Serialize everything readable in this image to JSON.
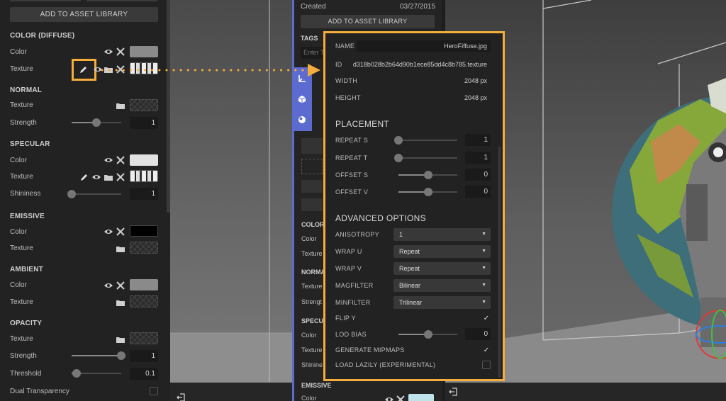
{
  "left_panel": {
    "add_to_library": "ADD TO ASSET LIBRARY",
    "sections": {
      "color_diffuse": "COLOR (DIFFUSE)",
      "normal": "NORMAL",
      "specular": "SPECULAR",
      "emissive": "EMISSIVE",
      "ambient": "AMBIENT",
      "opacity": "OPACITY"
    },
    "labels": {
      "color": "Color",
      "texture": "Texture",
      "strength": "Strength",
      "shininess": "Shininess",
      "threshold": "Threshold",
      "dual_transparency": "Dual Transparency"
    },
    "values": {
      "normal_strength": "1",
      "specular_shininess": "1",
      "opacity_strength": "1",
      "opacity_threshold": "0.1"
    },
    "slider_levels": {
      "normal_strength": 0.5,
      "specular_shininess": 0.0,
      "opacity_strength": 1.0,
      "opacity_threshold": 0.1
    },
    "swatch_colors": {
      "diffuse": "#8a8a8a",
      "specular": "#e2e2e2",
      "emissive": "#000000",
      "ambient": "#8a8a8a"
    },
    "dual_transparency_checked": false
  },
  "mid_panel": {
    "created_label": "Created",
    "created_date": "03/27/2015",
    "add_to_library": "ADD TO ASSET LIBRARY",
    "tags_label": "TAGS",
    "tags_placeholder": "Enter T",
    "color_section": "COLOR",
    "color_label": "Color",
    "texture_label": "Texture",
    "normal_section": "NORMA",
    "normal_texture": "Texture",
    "normal_strength": "Strengt",
    "specular_section": "SPECU",
    "specular_color": "Color",
    "specular_texture": "Texture",
    "specular_shininess": "Shinine",
    "emissive_section": "EMISSIVE",
    "emissive_color": "Color",
    "emissive_swatch_color": "#bfe3ea"
  },
  "texture_popup": {
    "name_label": "NAME",
    "name_value": "HeroFiffuse.jpg",
    "id_label": "ID",
    "id_value": "d318b028b2b64d90b1ece85dd4c8b785.texture",
    "width_label": "WIDTH",
    "width_value": "2048 px",
    "height_label": "HEIGHT",
    "height_value": "2048 px",
    "placement_title": "PLACEMENT",
    "repeat_s_label": "REPEAT S",
    "repeat_s_value": "1",
    "repeat_t_label": "REPEAT T",
    "repeat_t_value": "1",
    "offset_s_label": "OFFSET S",
    "offset_s_value": "0",
    "offset_v_label": "OFFSET V",
    "offset_v_value": "0",
    "advanced_title": "ADVANCED OPTIONS",
    "anisotropy_label": "ANISOTROPY",
    "anisotropy_value": "1",
    "wrap_u_label": "WRAP U",
    "wrap_u_value": "Repeat",
    "wrap_v_label": "WRAP V",
    "wrap_v_value": "Repeat",
    "magfilter_label": "MAGFILTER",
    "magfilter_value": "Bilinear",
    "minfilter_label": "MINFILTER",
    "minfilter_value": "Trilinear",
    "flip_y_label": "FLIP Y",
    "flip_y_checked": true,
    "lod_bias_label": "LOD BIAS",
    "lod_bias_value": "0",
    "generate_mipmaps_label": "GENERATE MIPMAPS",
    "generate_mipmaps_checked": true,
    "load_lazily_label": "LOAD LAZILY (EXPERIMENTAL)",
    "load_lazily_checked": false,
    "slider_levels": {
      "repeat_s": 0.0,
      "repeat_t": 0.0,
      "offset_s": 0.5,
      "offset_v": 0.5,
      "lod_bias": 0.5
    }
  },
  "accent_color": "#f5ad3c",
  "check_glyph": "✓"
}
